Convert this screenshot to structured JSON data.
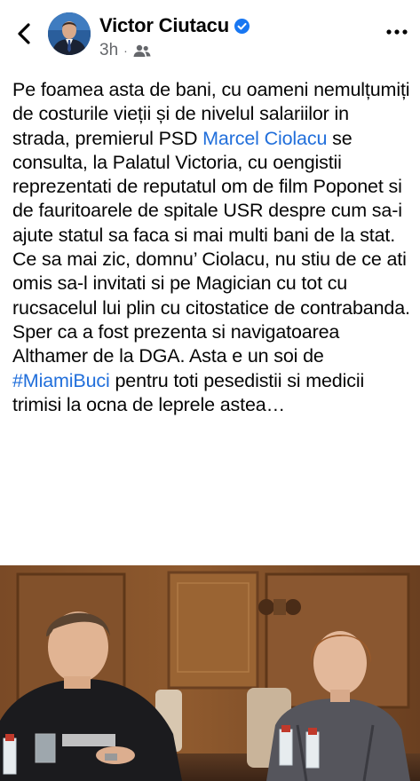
{
  "post": {
    "author": "Victor Ciutacu",
    "time": "3h",
    "separator": "·",
    "text_parts": [
      "Pe foamea asta de bani, cu oameni nemulțumiți de costurile vieții și de nivelul salariilor in strada, premierul PSD ",
      "Marcel Ciolacu",
      " se consulta, la Palatul Victoria, cu oengistii reprezentati de reputatul om de film Poponet si de fauritoarele de spitale USR despre cum sa-i ajute statul sa faca si mai multi bani de la stat. Ce sa mai zic, domnu’ Ciolacu, nu stiu de ce ati omis sa-l invitati si pe Magician cu tot cu rucsacelul lui plin cu citostatice de contrabanda. Sper ca a fost prezenta si navigatoarea Althamer de la DGA. Asta e un soi de ",
      "#MiamiBuci",
      " pentru toti pesedistii si medicii trimisi la ocna de leprele astea…"
    ]
  },
  "colors": {
    "link": "#216fdb",
    "verified": "#1877f2",
    "meta": "#65676b"
  },
  "icons": [
    "back-icon",
    "verified-badge-icon",
    "friends-audience-icon",
    "more-options-icon"
  ]
}
